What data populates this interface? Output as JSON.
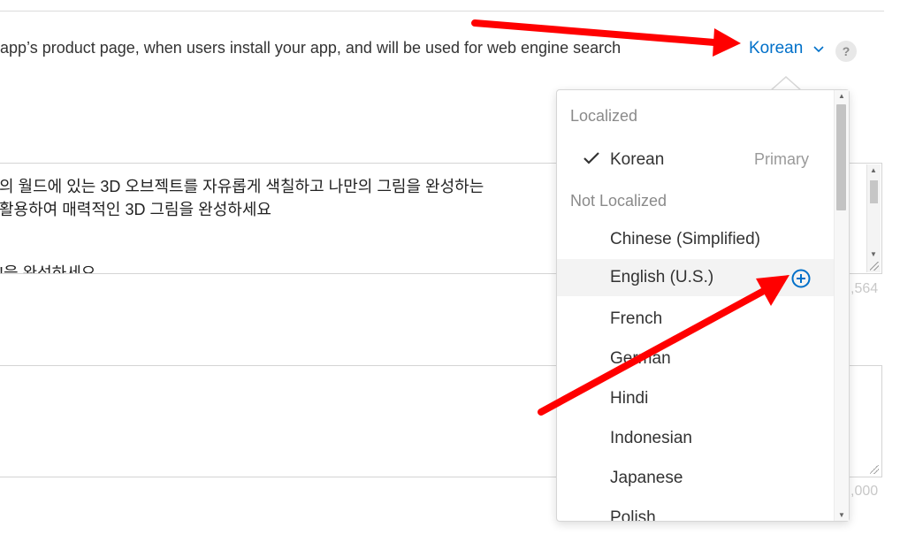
{
  "header": {
    "description": "app’s product page, when users install your app, and will be used for web engine search",
    "language_selected": "Korean",
    "help_label": "?"
  },
  "promo_text": {
    "line1": "의 월드에 있는 3D 오브젝트를 자유롭게 색칠하고 나만의 그림을 완성하는",
    "line2": "활용하여 매력적인 3D 그림을 완성하세요",
    "line3": "!을 완성하세요",
    "counter": ",564"
  },
  "keywords": {
    "counter": ",000"
  },
  "dropdown": {
    "localized_header": "Localized",
    "primary_language": "Korean",
    "primary_badge": "Primary",
    "not_localized_header": "Not Localized",
    "items": [
      {
        "label": "Chinese (Simplified)"
      },
      {
        "label": "English (U.S.)"
      },
      {
        "label": "French"
      },
      {
        "label": "German"
      },
      {
        "label": "Hindi"
      },
      {
        "label": "Indonesian"
      },
      {
        "label": "Japanese"
      },
      {
        "label": "Polish"
      }
    ]
  },
  "colors": {
    "accent": "#0070c9",
    "annotation_arrow": "#ff0000",
    "muted_text": "#8a8a8a"
  },
  "icons": {
    "chevron": "chevron-down-icon",
    "check": "checkmark-icon",
    "add": "plus-circle-icon",
    "help": "help-icon"
  }
}
